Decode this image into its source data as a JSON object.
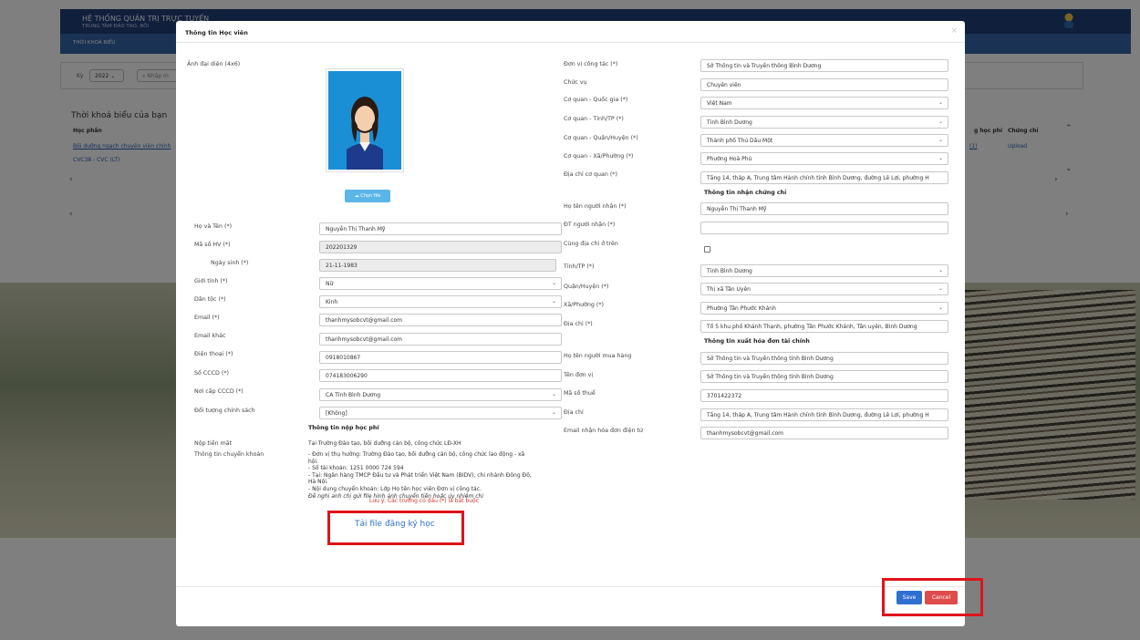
{
  "background": {
    "brand_line1": "HỆ THỐNG QUẢN TRỊ TRỰC TUYẾN",
    "brand_line2": "TRUNG TÂM ĐÀO TẠO, BỒI",
    "nav_tab": "THỜI KHOÁ BIỂU",
    "ky_label": "Kỳ",
    "year_value": "2022",
    "search_placeholder": "Nhập m",
    "section_title": "Thời khoá biểu của bạn",
    "th_hocphan": "Học phần",
    "row1_link": "Bồi dưỡng ngạch chuyên viên chính",
    "row2_text": "CVC38 - CVC (LT)",
    "th_hocphi": "g học phí",
    "th_chungchi": "Chứng chỉ",
    "upload_link": "Upload",
    "row1_extra": "(1)"
  },
  "modal": {
    "title": "Thông tin Học viên",
    "close_glyph": "×",
    "left": {
      "avatar_label": "Ảnh đại diện (4x6)",
      "choose_file": "Chọn file",
      "fields": [
        {
          "label": "Họ và Tên (*)",
          "value": "Nguyễn Thị Thanh Mỹ"
        },
        {
          "label": "Mã số HV (*)",
          "value": "202201329"
        },
        {
          "label": "Ngày sinh (*)",
          "value": "21-11-1983"
        },
        {
          "label": "Giới tính (*)",
          "value": "Nữ"
        },
        {
          "label": "Dân tộc (*)",
          "value": "Kinh"
        },
        {
          "label": "Email (*)",
          "value": "thanhmysobcvt@gmail.com"
        },
        {
          "label": "Email khác",
          "value": "thanhmysobcvt@gmail.com"
        },
        {
          "label": "Điện thoại (*)",
          "value": "0918010867"
        },
        {
          "label": "Số CCCD (*)",
          "value": "074183006290"
        },
        {
          "label": "Nơi cấp CCCD (*)",
          "value": "CA Tỉnh Bình Dương"
        },
        {
          "label": "Đối tượng chính sách",
          "value": "[Không]"
        }
      ],
      "fee_section_title": "Thông tin nộp học phí",
      "cash_label": "Nộp tiền mặt",
      "cash_value": "Tại Trường Đào tạo, bồi dưỡng cán bộ, công chức LĐ-XH",
      "transfer_label": "Thông tin chuyển khoản",
      "transfer_lines": [
        "- Đơn vị thụ hưởng: Trường Đào tạo, bồi dưỡng cán bộ, công chức lao động - xã",
        "hội.",
        "- Số tài khoản: 1251 0000 724 594",
        "- Tại: Ngân hàng TMCP Đầu tư và Phát triển Việt Nam (BIDV), chi nhánh Đông Đô,",
        "Hà Nội.",
        "- Nội dung chuyển khoản: Lớp   Họ tên học viên   Đơn vị công tác.",
        "Đề nghị anh chị gửi file hình ảnh chuyển tiền hoặc ủy nhiệm chi"
      ]
    },
    "right": {
      "fields_a": [
        {
          "label": "Đơn vị công tác (*)",
          "value": "Sở Thông tin và Truyền thông Bình Dương"
        },
        {
          "label": "Chức vụ",
          "value": "Chuyên viên"
        },
        {
          "label": "Cơ quan - Quốc gia (*)",
          "value": "Việt Nam"
        },
        {
          "label": "Cơ quan - Tỉnh/TP (*)",
          "value": "Tỉnh Bình Dương"
        },
        {
          "label": "Cơ quan - Quận/Huyện (*)",
          "value": "Thành phố Thủ Dầu Một"
        },
        {
          "label": "Cơ quan - Xã/Phường (*)",
          "value": "Phường Hoà Phú"
        },
        {
          "label": "Địa chỉ cơ quan (*)",
          "value": "Tầng 14, tháp A, Trung tâm Hành chính tỉnh Bình Dương, đường Lê Lợi, phường H"
        }
      ],
      "cert_section_title": "Thông tin nhận chứng chỉ",
      "fields_b": [
        {
          "label": "Họ tên người nhận (*)",
          "value": "Nguyễn Thị Thanh Mỹ"
        },
        {
          "label": "ĐT người nhận (*)",
          "value": ""
        }
      ],
      "same_address_label": "Cùng địa chỉ ở trên",
      "fields_c": [
        {
          "label": "Tỉnh/TP (*)",
          "value": "Tỉnh Bình Dương"
        },
        {
          "label": "Quận/Huyện (*)",
          "value": "Thị xã Tân Uyên"
        },
        {
          "label": "Xã/Phường (*)",
          "value": "Phường Tân Phước Khánh"
        },
        {
          "label": "Địa chỉ (*)",
          "value": "Tổ 5 khu phố Khánh Thạnh, phường Tân Phước Khánh, Tân uyên, Bình Dương"
        }
      ],
      "invoice_section_title": "Thông tin xuất hóa đơn tài chính",
      "fields_d": [
        {
          "label": "Họ tên người mua hàng",
          "value": "Sở Thông tin và Truyền thông tỉnh Bình Dương"
        },
        {
          "label": "Tên đơn vị",
          "value": "Sở Thông tin và Truyền thông tỉnh Bình Dương"
        },
        {
          "label": "Mã số thuế",
          "value": "3701422372"
        },
        {
          "label": "Địa chỉ",
          "value": "Tầng 14, tháp A, Trung tâm Hành chính tỉnh Bình Dương, đường Lê Lợi, phường H"
        },
        {
          "label": "Email nhận hóa đơn điện tử",
          "value": "thanhmysobcvt@gmail.com"
        }
      ]
    },
    "required_note": "Lưu ý: Các trường có dấu (*) là bắt buộc",
    "download_link": "Tải file đăng ký học",
    "save_label": "Save",
    "cancel_label": "Cancel"
  },
  "colors": {
    "primary_button": "#2f6fd0",
    "cancel_button": "#de4b4b",
    "highlight_border": "#e0131b",
    "link": "#2c6fc6",
    "header_bar": "#1f3e78"
  }
}
